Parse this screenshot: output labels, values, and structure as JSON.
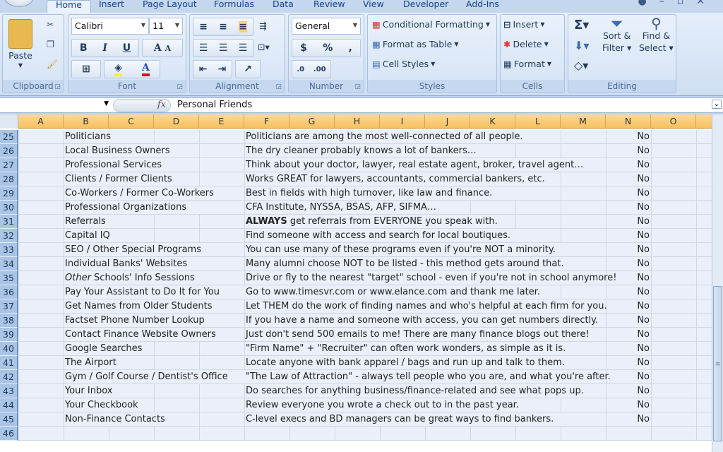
{
  "tabs": [
    "Home",
    "Insert",
    "Page Layout",
    "Formulas",
    "Data",
    "Review",
    "View",
    "Developer",
    "Add-Ins"
  ],
  "active_tab": "Home",
  "ribbon": {
    "clipboard": {
      "label": "Clipboard",
      "paste": "Paste"
    },
    "font": {
      "label": "Font",
      "name": "Calibri",
      "size": "11"
    },
    "alignment": {
      "label": "Alignment"
    },
    "number": {
      "label": "Number",
      "format": "General"
    },
    "styles": {
      "label": "Styles",
      "conditional": "Conditional Formatting",
      "format_table": "Format as Table",
      "cell_styles": "Cell Styles"
    },
    "cells": {
      "label": "Cells",
      "insert": "Insert",
      "delete": "Delete",
      "format": "Format"
    },
    "editing": {
      "label": "Editing",
      "sort1": "Sort &",
      "sort2": "Filter",
      "find1": "Find &",
      "find2": "Select"
    }
  },
  "formula_bar": {
    "fx": "fx",
    "value": "Personal Friends"
  },
  "columns": [
    "A",
    "B",
    "C",
    "D",
    "E",
    "F",
    "G",
    "H",
    "I",
    "J",
    "K",
    "L",
    "M",
    "N",
    "O"
  ],
  "rows": [
    {
      "n": "25",
      "b": "Politicians",
      "f": [
        {
          "t": "Politicians are among the most well-connected of all people."
        }
      ],
      "n_col": "No"
    },
    {
      "n": "26",
      "b": "Local Business Owners",
      "f": [
        {
          "t": "The dry cleaner probably knows a lot of bankers…"
        }
      ],
      "n_col": "No"
    },
    {
      "n": "27",
      "b": "Professional Services",
      "f": [
        {
          "t": "Think about your doctor, lawyer, real estate agent, broker, travel agent…"
        }
      ],
      "n_col": "No"
    },
    {
      "n": "28",
      "b": "Clients / Former Clients",
      "f": [
        {
          "t": "Works GREAT for lawyers, accountants, commercial bankers, etc."
        }
      ],
      "n_col": "No"
    },
    {
      "n": "29",
      "b": "Co-Workers / Former Co-Workers",
      "f": [
        {
          "t": "Best in fields with high turnover, like law and finance."
        }
      ],
      "n_col": "No"
    },
    {
      "n": "30",
      "b": "Professional Organizations",
      "f": [
        {
          "t": "CFA Institute, NYSSA, BSAS, AFP, SIFMA…"
        }
      ],
      "n_col": "No"
    },
    {
      "n": "31",
      "b": "Referrals",
      "f": [
        {
          "t": "ALWAYS",
          "s": "b"
        },
        {
          "t": " get referrals from EVERYONE you speak with."
        }
      ],
      "n_col": "No"
    },
    {
      "n": "32",
      "b": "Capital IQ",
      "f": [
        {
          "t": "Find someone with access and search for local boutiques."
        }
      ],
      "n_col": "No"
    },
    {
      "n": "33",
      "b": "SEO / Other Special Programs",
      "f": [
        {
          "t": "You can use many of these programs even if you're NOT a minority."
        }
      ],
      "n_col": "No"
    },
    {
      "n": "34",
      "b": "Individual Banks' Websites",
      "f": [
        {
          "t": "Many alumni choose NOT to be listed - this method gets around that."
        }
      ],
      "n_col": "No"
    },
    {
      "n": "35",
      "b_parts": [
        {
          "t": "Other",
          "s": "i"
        },
        {
          "t": " Schools' Info Sessions"
        }
      ],
      "f": [
        {
          "t": "Drive or fly to the nearest \"target\" school - even if you're not in school anymore!"
        }
      ],
      "n_col": "No"
    },
    {
      "n": "36",
      "b": "Pay Your Assistant to Do It for You",
      "f": [
        {
          "t": "Go to www.timesvr.com or www.elance.com and thank me later."
        }
      ],
      "n_col": "No"
    },
    {
      "n": "37",
      "b": "Get Names from Older Students",
      "f": [
        {
          "t": "Let THEM do the work of finding names and who's helpful at each firm for you."
        }
      ],
      "n_col": "No"
    },
    {
      "n": "38",
      "b": "Factset Phone Number Lookup",
      "f": [
        {
          "t": "If you have a name and someone with access, you can get numbers directly."
        }
      ],
      "n_col": "No"
    },
    {
      "n": "39",
      "b": "Contact Finance Website Owners",
      "f": [
        {
          "t": "Just don't send 500 emails to me! There are many finance blogs out there!"
        }
      ],
      "n_col": "No"
    },
    {
      "n": "40",
      "b": "Google Searches",
      "f": [
        {
          "t": "\"Firm Name\" + \"Recruiter\" can often work wonders, as simple as it is."
        }
      ],
      "n_col": "No"
    },
    {
      "n": "41",
      "b": "The Airport",
      "f": [
        {
          "t": "Locate anyone with bank apparel / bags and run up and talk to them."
        }
      ],
      "n_col": "No"
    },
    {
      "n": "42",
      "b": "Gym / Golf Course / Dentist's Office",
      "f": [
        {
          "t": "\"The Law of Attraction\" - always tell people who you are, and what you're after."
        }
      ],
      "n_col": "No"
    },
    {
      "n": "43",
      "b": "Your Inbox",
      "f": [
        {
          "t": "Do searches for anything business/finance-related and see what pops up."
        }
      ],
      "n_col": "No"
    },
    {
      "n": "44",
      "b": "Your Checkbook",
      "f": [
        {
          "t": "Review everyone you wrote a check out to in the past year."
        }
      ],
      "n_col": "No"
    },
    {
      "n": "45",
      "b": "Non-Finance Contacts",
      "f": [
        {
          "t": "C-level execs and BD managers can be great ways to find bankers."
        }
      ],
      "n_col": "No"
    },
    {
      "n": "46",
      "b": "",
      "f": [],
      "n_col": ""
    }
  ]
}
